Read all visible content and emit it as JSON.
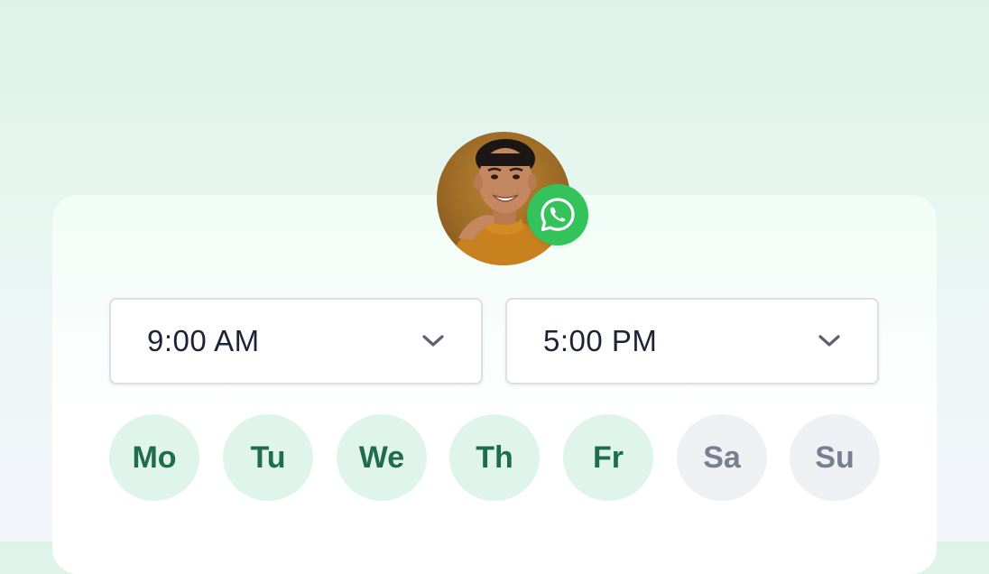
{
  "contact": {
    "avatar_icon": "person-avatar",
    "badge_icon": "whatsapp-icon",
    "badge_color": "#33c35a"
  },
  "hours": {
    "start": {
      "value": "9:00 AM",
      "icon": "chevron-down-icon"
    },
    "end": {
      "value": "5:00 PM",
      "icon": "chevron-down-icon"
    }
  },
  "days": [
    {
      "label": "Mo",
      "selected": true
    },
    {
      "label": "Tu",
      "selected": true
    },
    {
      "label": "We",
      "selected": true
    },
    {
      "label": "Th",
      "selected": true
    },
    {
      "label": "Fr",
      "selected": true
    },
    {
      "label": "Sa",
      "selected": false
    },
    {
      "label": "Su",
      "selected": false
    }
  ],
  "colors": {
    "selected_bg": "#dff5ec",
    "selected_text": "#1f6d4d",
    "unselected_bg": "#eef0f3",
    "unselected_text": "#7a7f8f"
  }
}
